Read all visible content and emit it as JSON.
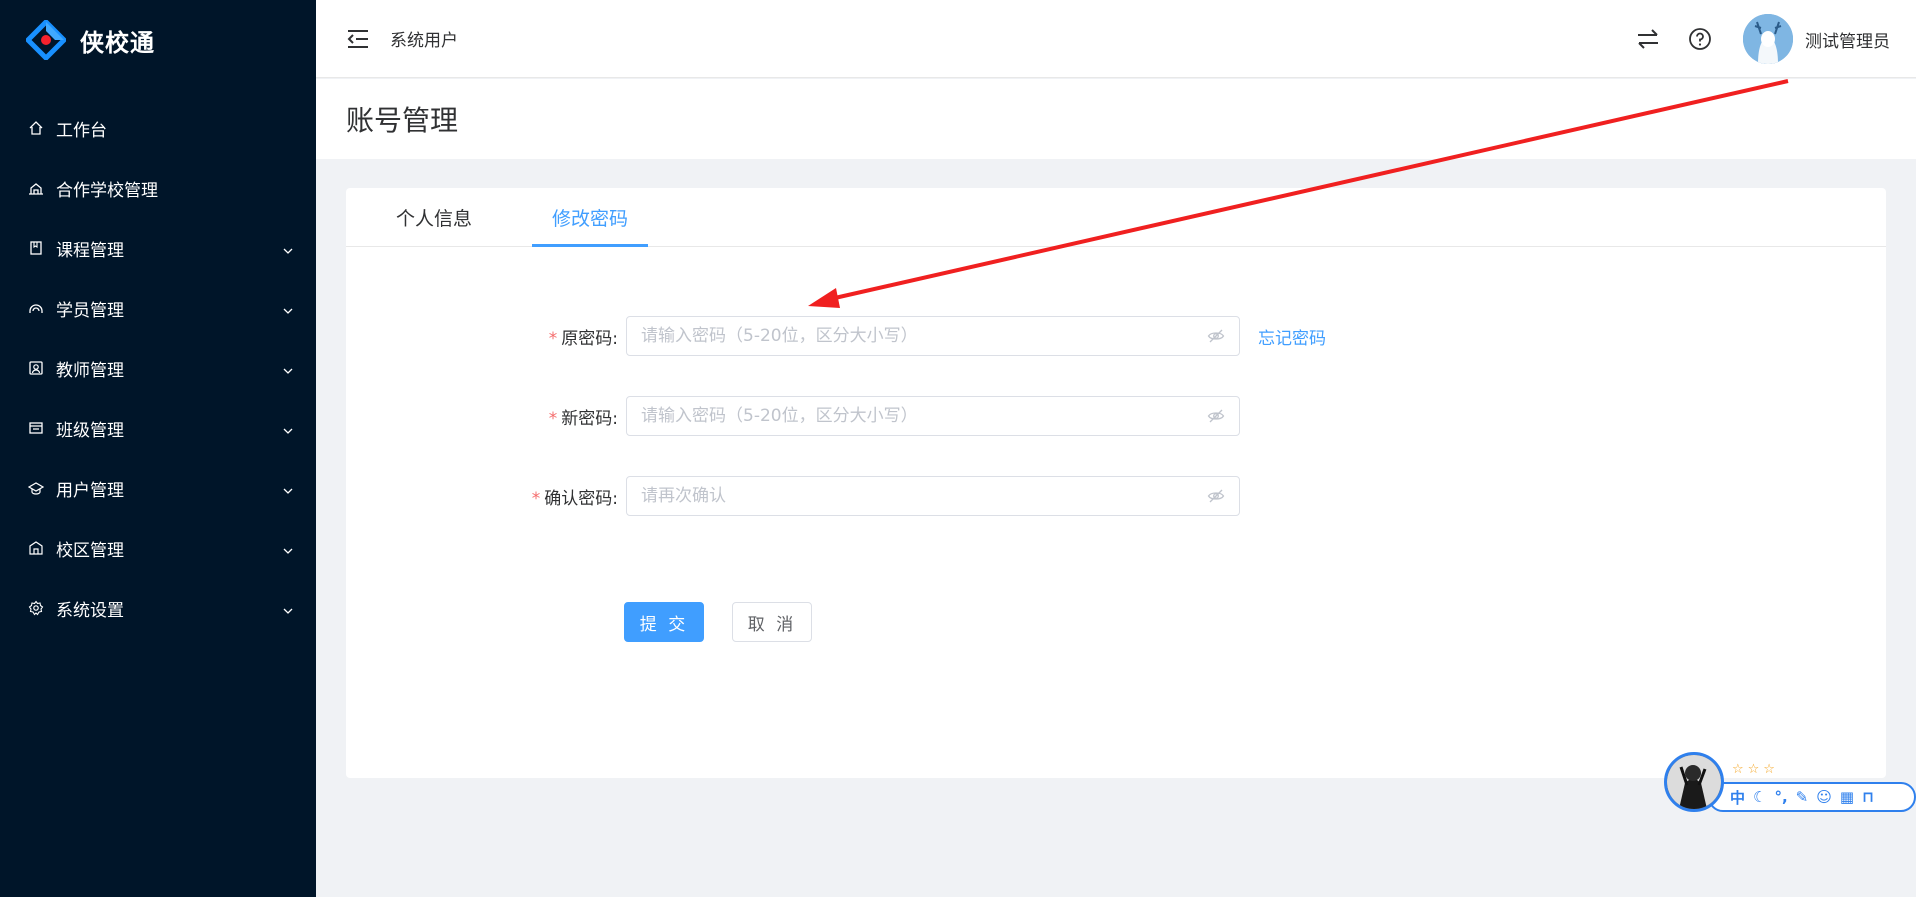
{
  "brand": {
    "name": "侠校通"
  },
  "sidebar": {
    "items": [
      {
        "label": "工作台",
        "icon": "home-icon",
        "has_arrow": false
      },
      {
        "label": "合作学校管理",
        "icon": "school-icon",
        "has_arrow": false
      },
      {
        "label": "课程管理",
        "icon": "book-icon",
        "has_arrow": true
      },
      {
        "label": "学员管理",
        "icon": "student-icon",
        "has_arrow": true
      },
      {
        "label": "教师管理",
        "icon": "teacher-icon",
        "has_arrow": true
      },
      {
        "label": "班级管理",
        "icon": "class-icon",
        "has_arrow": true
      },
      {
        "label": "用户管理",
        "icon": "user-icon",
        "has_arrow": true
      },
      {
        "label": "校区管理",
        "icon": "campus-icon",
        "has_arrow": true
      },
      {
        "label": "系统设置",
        "icon": "settings-icon",
        "has_arrow": true
      }
    ]
  },
  "header": {
    "breadcrumb": "系统用户",
    "user_name": "测试管理员"
  },
  "page": {
    "title": "账号管理"
  },
  "tabs": [
    {
      "label": "个人信息",
      "active": false
    },
    {
      "label": "修改密码",
      "active": true
    }
  ],
  "form": {
    "old_password": {
      "label": "原密码:",
      "placeholder": "请输入密码（5-20位，区分大小写）",
      "value": ""
    },
    "new_password": {
      "label": "新密码:",
      "placeholder": "请输入密码（5-20位，区分大小写）",
      "value": ""
    },
    "confirm_password": {
      "label": "确认密码:",
      "placeholder": "请再次确认",
      "value": ""
    },
    "forgot_link": "忘记密码",
    "submit_label": "提 交",
    "cancel_label": "取 消"
  },
  "ime": {
    "mode": "中"
  },
  "colors": {
    "sidebar_bg": "#001529",
    "primary": "#409eff",
    "required": "#f56c6c",
    "annotation_arrow": "#f02020"
  }
}
